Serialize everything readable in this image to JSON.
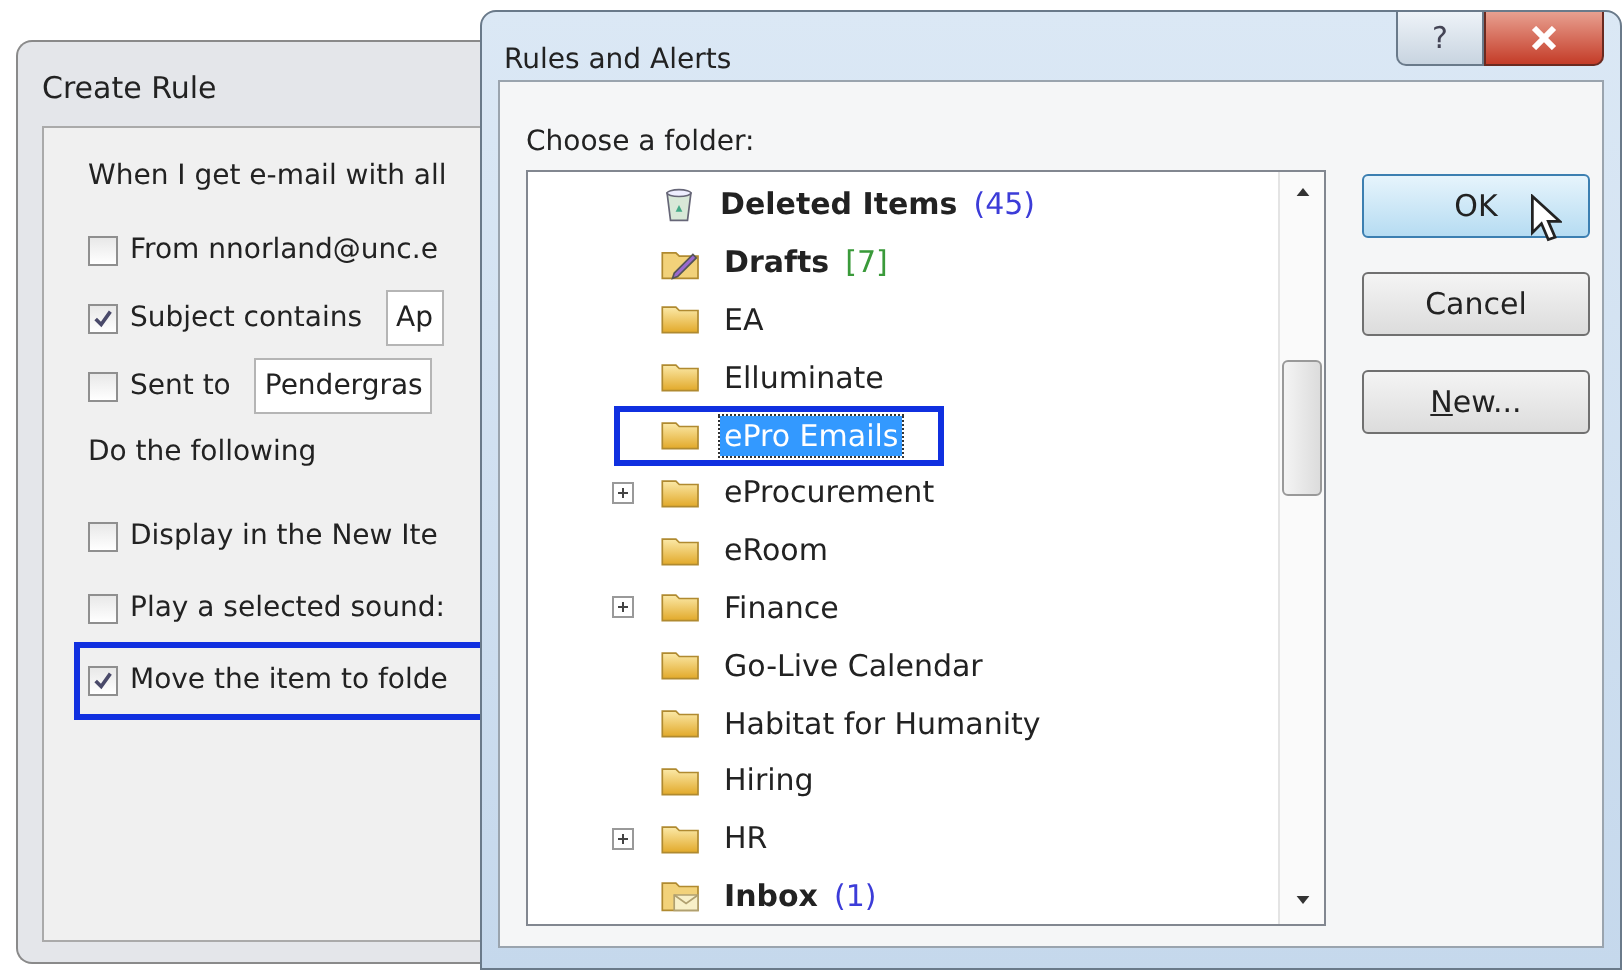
{
  "create_rule": {
    "title": "Create Rule",
    "section_conditions": "When I get e-mail with all",
    "conditions": [
      {
        "label": "From nnorland@unc.e",
        "checked": false
      },
      {
        "label": "Subject contains",
        "checked": true,
        "value": "Ap"
      },
      {
        "label": "Sent to",
        "checked": false,
        "value": "Pendergras"
      }
    ],
    "section_actions": "Do the following",
    "actions": [
      {
        "label": "Display in the New Ite",
        "checked": false,
        "highlighted": false
      },
      {
        "label": "Play a selected sound:",
        "checked": false,
        "highlighted": false
      },
      {
        "label": "Move the item to folde",
        "checked": true,
        "highlighted": true
      }
    ]
  },
  "rules_and_alerts": {
    "title": "Rules and Alerts",
    "help": "?",
    "prompt": "Choose a folder:",
    "folders": [
      {
        "name": "Deleted Items",
        "kind": "trash",
        "bold": true,
        "count": "(45)",
        "color": "#3c3cd8",
        "expandable": false,
        "selected": false
      },
      {
        "name": "Drafts",
        "kind": "drafts",
        "bold": true,
        "count": "[7]",
        "color": "#3a9a3a",
        "expandable": false,
        "selected": false
      },
      {
        "name": "EA",
        "kind": "folder",
        "bold": false,
        "expandable": false,
        "selected": false
      },
      {
        "name": "Elluminate",
        "kind": "folder",
        "bold": false,
        "expandable": false,
        "selected": false
      },
      {
        "name": "ePro Emails",
        "kind": "folder",
        "bold": false,
        "expandable": false,
        "selected": true
      },
      {
        "name": "eProcurement",
        "kind": "folder",
        "bold": false,
        "expandable": true,
        "selected": false
      },
      {
        "name": "eRoom",
        "kind": "folder",
        "bold": false,
        "expandable": false,
        "selected": false
      },
      {
        "name": "Finance",
        "kind": "folder",
        "bold": false,
        "expandable": true,
        "selected": false
      },
      {
        "name": "Go-Live Calendar",
        "kind": "folder",
        "bold": false,
        "expandable": false,
        "selected": false
      },
      {
        "name": "Habitat for Humanity",
        "kind": "folder",
        "bold": false,
        "expandable": false,
        "selected": false
      },
      {
        "name": "Hiring",
        "kind": "folder",
        "bold": false,
        "expandable": false,
        "selected": false
      },
      {
        "name": "HR",
        "kind": "folder",
        "bold": false,
        "expandable": true,
        "selected": false
      },
      {
        "name": "Inbox",
        "kind": "inbox",
        "bold": true,
        "count": "(1)",
        "color": "#3c3cd8",
        "expandable": false,
        "selected": false
      }
    ],
    "buttons": [
      {
        "label": "OK",
        "default": true
      },
      {
        "label": "Cancel",
        "default": false
      },
      {
        "label": "New...",
        "default": false
      }
    ]
  }
}
